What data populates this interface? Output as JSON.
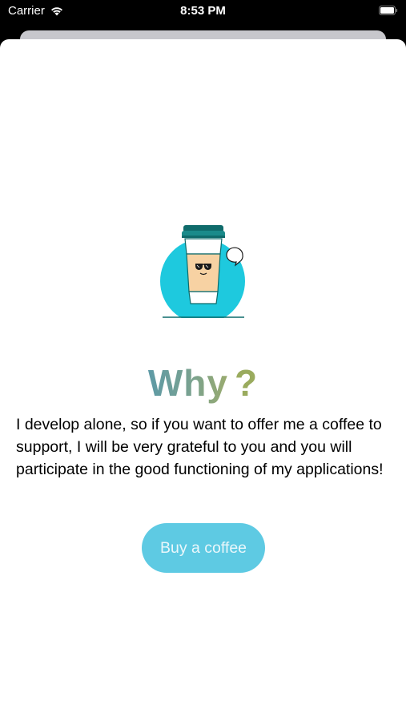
{
  "status_bar": {
    "carrier": "Carrier",
    "time": "8:53 PM"
  },
  "content": {
    "title": "Why",
    "title_mark": "?",
    "message": "I develop alone, so if you want to offer me a coffee to support, I will be very grateful to you and you will participate in the good functioning of my applications!",
    "button_label": "Buy a coffee"
  },
  "illustration": {
    "name": "coffee-cup-icon"
  },
  "colors": {
    "button_bg": "#5ecae3",
    "button_text": "#eaf7fb",
    "title_gradient_start": "#5e9aa6",
    "title_gradient_end": "#9aab6e",
    "circle": "#1ec9de",
    "cup_body": "#f7d2a3",
    "lid": "#0f6b6b"
  }
}
